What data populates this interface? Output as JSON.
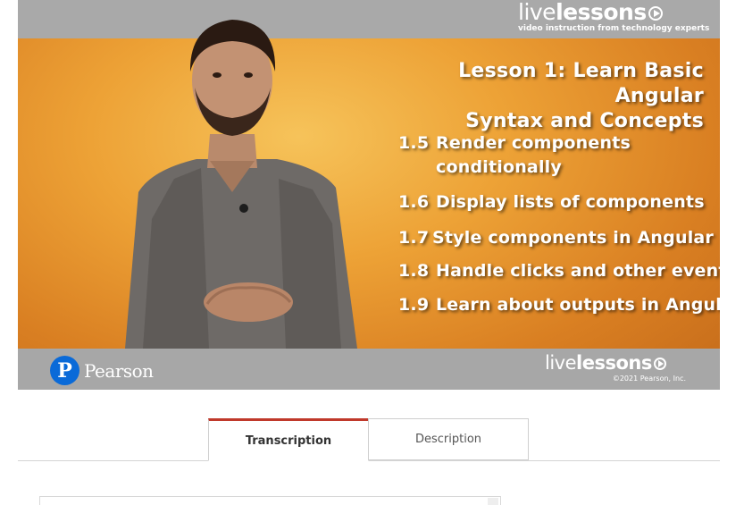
{
  "video": {
    "brand_live": "live",
    "brand_lessons": "lessons",
    "brand_tagline": "video instruction from technology experts",
    "lesson_title_line1": "Lesson 1: Learn Basic Angular",
    "lesson_title_line2": "Syntax and Concepts",
    "topics": [
      {
        "num": "1.5",
        "text": "Render components",
        "cont": "conditionally"
      },
      {
        "num": "1.6",
        "text": "Display lists of components"
      },
      {
        "num": "1.7",
        "text": "Style components in Angular"
      },
      {
        "num": "1.8",
        "text": "Handle clicks and other events"
      },
      {
        "num": "1.9",
        "text": "Learn about outputs in Angular"
      }
    ],
    "pearson_mark": "P",
    "pearson_label": "Pearson",
    "copyright": "©2021 Pearson, Inc."
  },
  "tabs": [
    {
      "label": "Transcription",
      "active": true
    },
    {
      "label": "Description",
      "active": false
    }
  ],
  "colors": {
    "active_tab_accent": "#c0392b",
    "band_gray": "#a9a9a9",
    "pearson_blue": "#0a6ad8"
  },
  "icons": [
    "play-icon",
    "pearson-logo-icon"
  ]
}
